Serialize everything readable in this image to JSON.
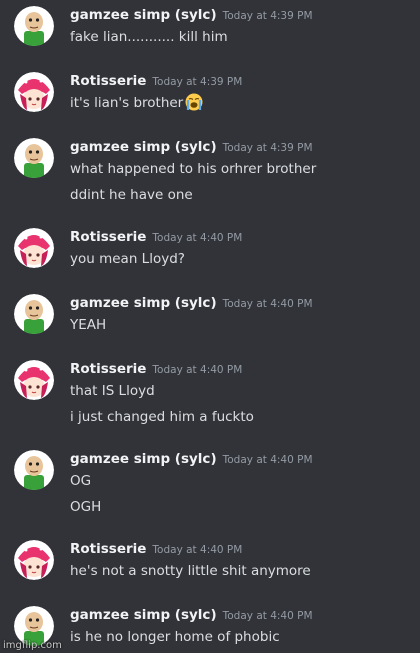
{
  "messages": [
    {
      "author": "gamzee simp (sylc)",
      "avatar": "baldi-avatar",
      "time": "Today at 4:39 PM",
      "lines": [
        "fake lian........... kill him"
      ]
    },
    {
      "author": "Rotisserie",
      "avatar": "strawberry-avatar",
      "time": "Today at 4:39 PM",
      "lines": [
        "it's lian's brother"
      ],
      "emoji": "loudly-crying-face"
    },
    {
      "author": "gamzee simp (sylc)",
      "avatar": "baldi-avatar",
      "time": "Today at 4:39 PM",
      "lines": [
        "what happened to his orhrer brother",
        "ddint he have one"
      ]
    },
    {
      "author": "Rotisserie",
      "avatar": "strawberry-avatar",
      "time": "Today at 4:40 PM",
      "lines": [
        "you mean Lloyd?"
      ]
    },
    {
      "author": "gamzee simp (sylc)",
      "avatar": "baldi-avatar",
      "time": "Today at 4:40 PM",
      "lines": [
        "YEAH"
      ]
    },
    {
      "author": "Rotisserie",
      "avatar": "strawberry-avatar",
      "time": "Today at 4:40 PM",
      "lines": [
        "that IS Lloyd",
        "i just changed him a fuckto"
      ]
    },
    {
      "author": "gamzee simp (sylc)",
      "avatar": "baldi-avatar",
      "time": "Today at 4:40 PM",
      "lines": [
        "OG",
        "OGH"
      ]
    },
    {
      "author": "Rotisserie",
      "avatar": "strawberry-avatar",
      "time": "Today at 4:40 PM",
      "lines": [
        "he's not a snotty little shit anymore"
      ]
    },
    {
      "author": "gamzee simp (sylc)",
      "avatar": "baldi-avatar",
      "time": "Today at 4:40 PM",
      "lines": [
        "is he no longer home of phobic"
      ]
    }
  ],
  "watermark": "imgflip.com",
  "colors": {
    "background": "#313338",
    "author": "#f2f3f5",
    "text": "#dbdee1",
    "timestamp": "#949ba4"
  }
}
